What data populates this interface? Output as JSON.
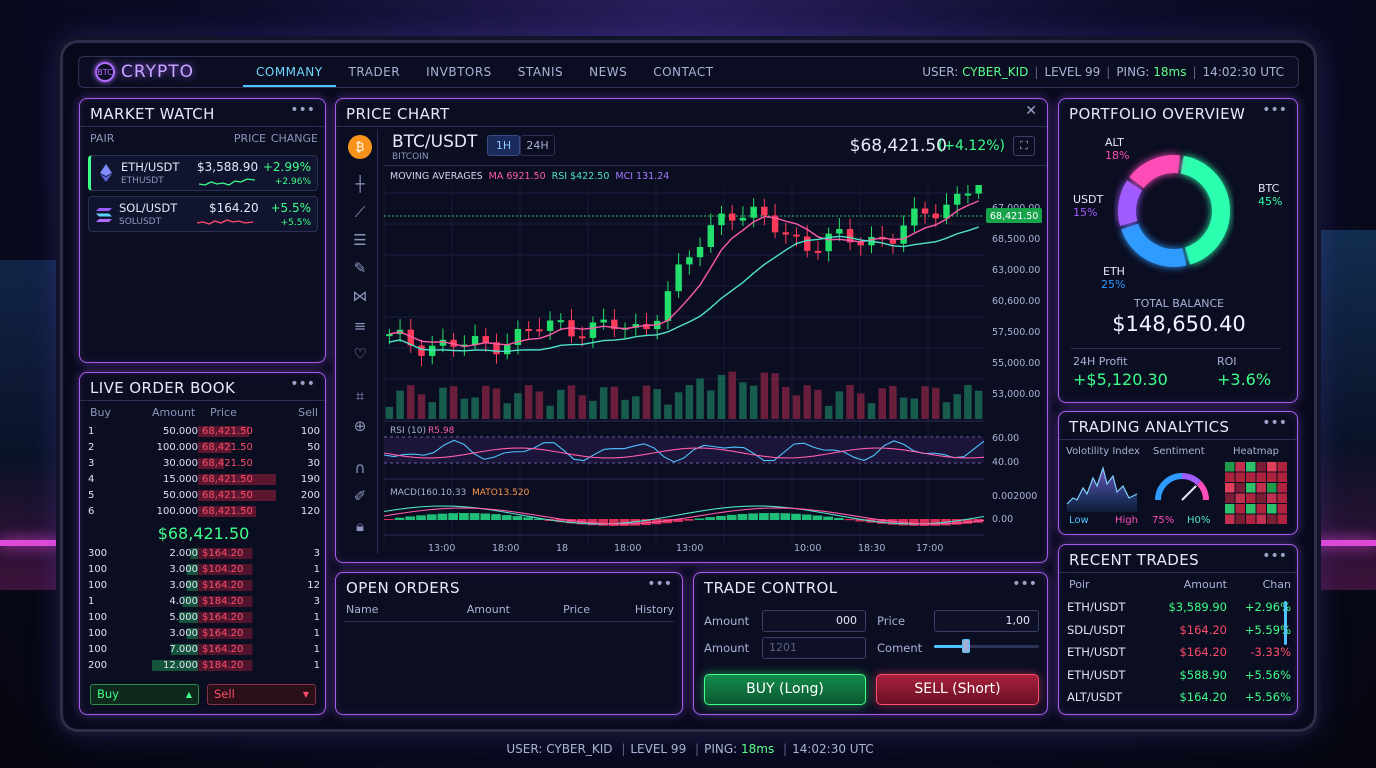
{
  "app": {
    "logo_text": "CRYPTO",
    "logo_mark": "BTC"
  },
  "nav": {
    "items": [
      "COMMANY",
      "TRADER",
      "INVBTORS",
      "STANIS",
      "NEWS",
      "CONTACT"
    ],
    "active": 0
  },
  "status": {
    "user_label": "USER:",
    "user": "CYBER_KID",
    "level": "LEVEL 99",
    "ping_label": "PING:",
    "ping": "18ms",
    "time": "14:02:30 UTC"
  },
  "market_watch": {
    "title": "MARKET WATCH",
    "headers": [
      "PAIR",
      "PRICE",
      "CHANGE"
    ],
    "items": [
      {
        "pair": "ETH/USDT",
        "sub": "ETHUSDT",
        "price": "$3,588.90",
        "change": "+2.99%",
        "change2": "+2.96%",
        "icon": "ethereum-icon"
      },
      {
        "pair": "SOL/USDT",
        "sub": "SOLUSDT",
        "price": "$164.20",
        "change": "+5.5%",
        "change2": "+5.5%",
        "icon": "solana-icon"
      }
    ]
  },
  "order_book": {
    "title": "LIVE ORDER BOOK",
    "headers": [
      "Buy",
      "Amount",
      "Price",
      "Sell"
    ],
    "asks": [
      [
        "1",
        "50.000",
        "68,421.50",
        "100"
      ],
      [
        "2",
        "100.000",
        "68,421.50",
        "50"
      ],
      [
        "3",
        "30.000",
        "68,421.50",
        "30"
      ],
      [
        "4",
        "15.000",
        "68,421.50",
        "190"
      ],
      [
        "5",
        "50.000",
        "68,421.50",
        "200"
      ],
      [
        "6",
        "100.000",
        "68,421.50",
        "120"
      ]
    ],
    "mid_price": "$68,421.50",
    "bids": [
      [
        "300",
        "2.000",
        "$164.20",
        "3"
      ],
      [
        "100",
        "3.000",
        "$104.20",
        "1"
      ],
      [
        "100",
        "3.000",
        "$164.20",
        "12"
      ],
      [
        "1",
        "4.000",
        "$184.20",
        "3"
      ],
      [
        "100",
        "5.000",
        "$164.20",
        "1"
      ],
      [
        "100",
        "3.000",
        "$164.20",
        "1"
      ],
      [
        "100",
        "7.000",
        "$164.20",
        "1"
      ],
      [
        "200",
        "12.000",
        "$184.20",
        "1"
      ]
    ],
    "buy_label": "Buy",
    "sell_label": "Sell"
  },
  "price_chart": {
    "title": "PRICE CHART",
    "pair": "BTC/USDT",
    "pair_sub": "BITCOIN",
    "timeframes": [
      "1H",
      "24H"
    ],
    "active_tf": 0,
    "price": "$68,421.50",
    "change": "(+4.12%)",
    "ma_label": "MOVING AVERAGES",
    "ma": "MA 6921.50",
    "rsi": "RSI $422.50",
    "mci": "MCI 131.24",
    "y_ticks": [
      "67,000.00",
      "68,500.00",
      "63,000.00",
      "60,600.00",
      "57,500.00",
      "55,000.00",
      "53,000.00"
    ],
    "current_label": "68,421.50",
    "rsi_label": "RSI (10)",
    "rsi_val": "R5.98",
    "rsi_ticks": [
      "60.00",
      "40.00"
    ],
    "macd_label": "MACD(160.10.33",
    "macd_val": "MATO13.520",
    "macd_ticks": [
      "0.002000",
      "0.00"
    ],
    "x_ticks": [
      "13:00",
      "18:00",
      "18",
      "18:00",
      "13:00",
      "10:00",
      "18:30",
      "17:00"
    ]
  },
  "chart_data": {
    "type": "line",
    "title": "BTC/USDT",
    "x": [
      "13:00",
      "18:00",
      "18",
      "18:00",
      "13:00",
      "10:00",
      "18:30",
      "17:00"
    ],
    "series": [
      {
        "name": "BTC/USDT",
        "values": [
          56000,
          55500,
          57200,
          56800,
          66500,
          63500,
          64200,
          68421.5
        ]
      }
    ],
    "ylabel": "",
    "xlabel": ""
  },
  "open_orders": {
    "title": "OPEN ORDERS",
    "headers": [
      "Name",
      "Amount",
      "Price",
      "History"
    ]
  },
  "trade_control": {
    "title": "TRADE CONTROL",
    "amount_label": "Amount",
    "amount_value": "000",
    "price_label": "Price",
    "price_value": "1,00",
    "amount2_label": "Amount",
    "amount2_placeholder": "1201",
    "comment_label": "Coment",
    "slider_value": 0.3,
    "buy_label": "BUY (Long)",
    "sell_label": "SELL (Short)"
  },
  "portfolio": {
    "title": "PORTFOLIO OVERVIEW",
    "slices": [
      {
        "name": "BTC",
        "pct": "45%",
        "value": 45,
        "color": "#2dffb0"
      },
      {
        "name": "ETH",
        "pct": "25%",
        "value": 25,
        "color": "#2f9bff"
      },
      {
        "name": "USDT",
        "pct": "15%",
        "value": 15,
        "color": "#a05cff"
      },
      {
        "name": "ALT",
        "pct": "18%",
        "value": 18,
        "color": "#ff4db8"
      }
    ],
    "total_label": "TOTAL BALANCE",
    "total": "$148,650.40",
    "profit_label": "24H Profit",
    "profit": "+$5,120.30",
    "roi_label": "ROI",
    "roi": "+3.6%"
  },
  "analytics": {
    "title": "TRADING ANALYTICS",
    "vol_label": "Volotility Index",
    "sent_label": "Sentiment",
    "heat_label": "Heatmap",
    "low": "Low",
    "high": "High",
    "pct1": "75%",
    "pct2": "H0%",
    "gauge_level": 0.75
  },
  "recent_trades": {
    "title": "RECENT TRADES",
    "headers": [
      "Poir",
      "Amount",
      "Chan"
    ],
    "rows": [
      {
        "pair": "ETH/USDT",
        "amount": "$3,589.90",
        "change": "+2.96%",
        "up": true
      },
      {
        "pair": "SDL/USDT",
        "amount": "$164.20",
        "change": "+5.59%",
        "up": false
      },
      {
        "pair": "ETH/USDT",
        "amount": "$164.20",
        "change": "-3.33%",
        "up": false
      },
      {
        "pair": "ETH/USDT",
        "amount": "$588.90",
        "change": "+5.56%",
        "up": true
      },
      {
        "pair": "ALT/USDT",
        "amount": "$164.20",
        "change": "+5.56%",
        "up": true
      }
    ]
  },
  "bottom_status": {
    "text": "USER: CYBER_KID",
    "level": "LEVEL 99",
    "ping_label": "PING:",
    "ping": "18ms",
    "time": "14:02:30 UTC"
  }
}
